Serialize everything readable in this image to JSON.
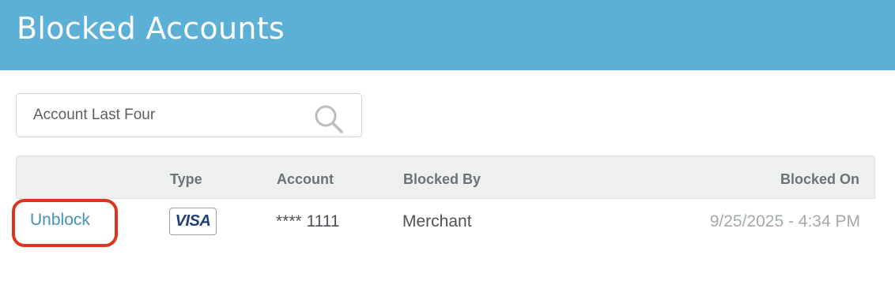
{
  "header": {
    "title": "Blocked Accounts",
    "background_color": "#5cb0d5"
  },
  "search": {
    "placeholder": "Account Last Four",
    "icon": "search-icon"
  },
  "table": {
    "columns": [
      "",
      "Type",
      "Account",
      "Blocked By",
      "Blocked On"
    ],
    "rows": [
      {
        "action": "Unblock",
        "type": "VISA",
        "account": "**** 1111",
        "blocked_by": "Merchant",
        "blocked_on": "9/25/2025 - 4:34 PM"
      }
    ]
  },
  "colors": {
    "accent_link": "#3f93b8",
    "highlight_outline": "#d9381e",
    "visa_blue": "#1e3f7a"
  }
}
